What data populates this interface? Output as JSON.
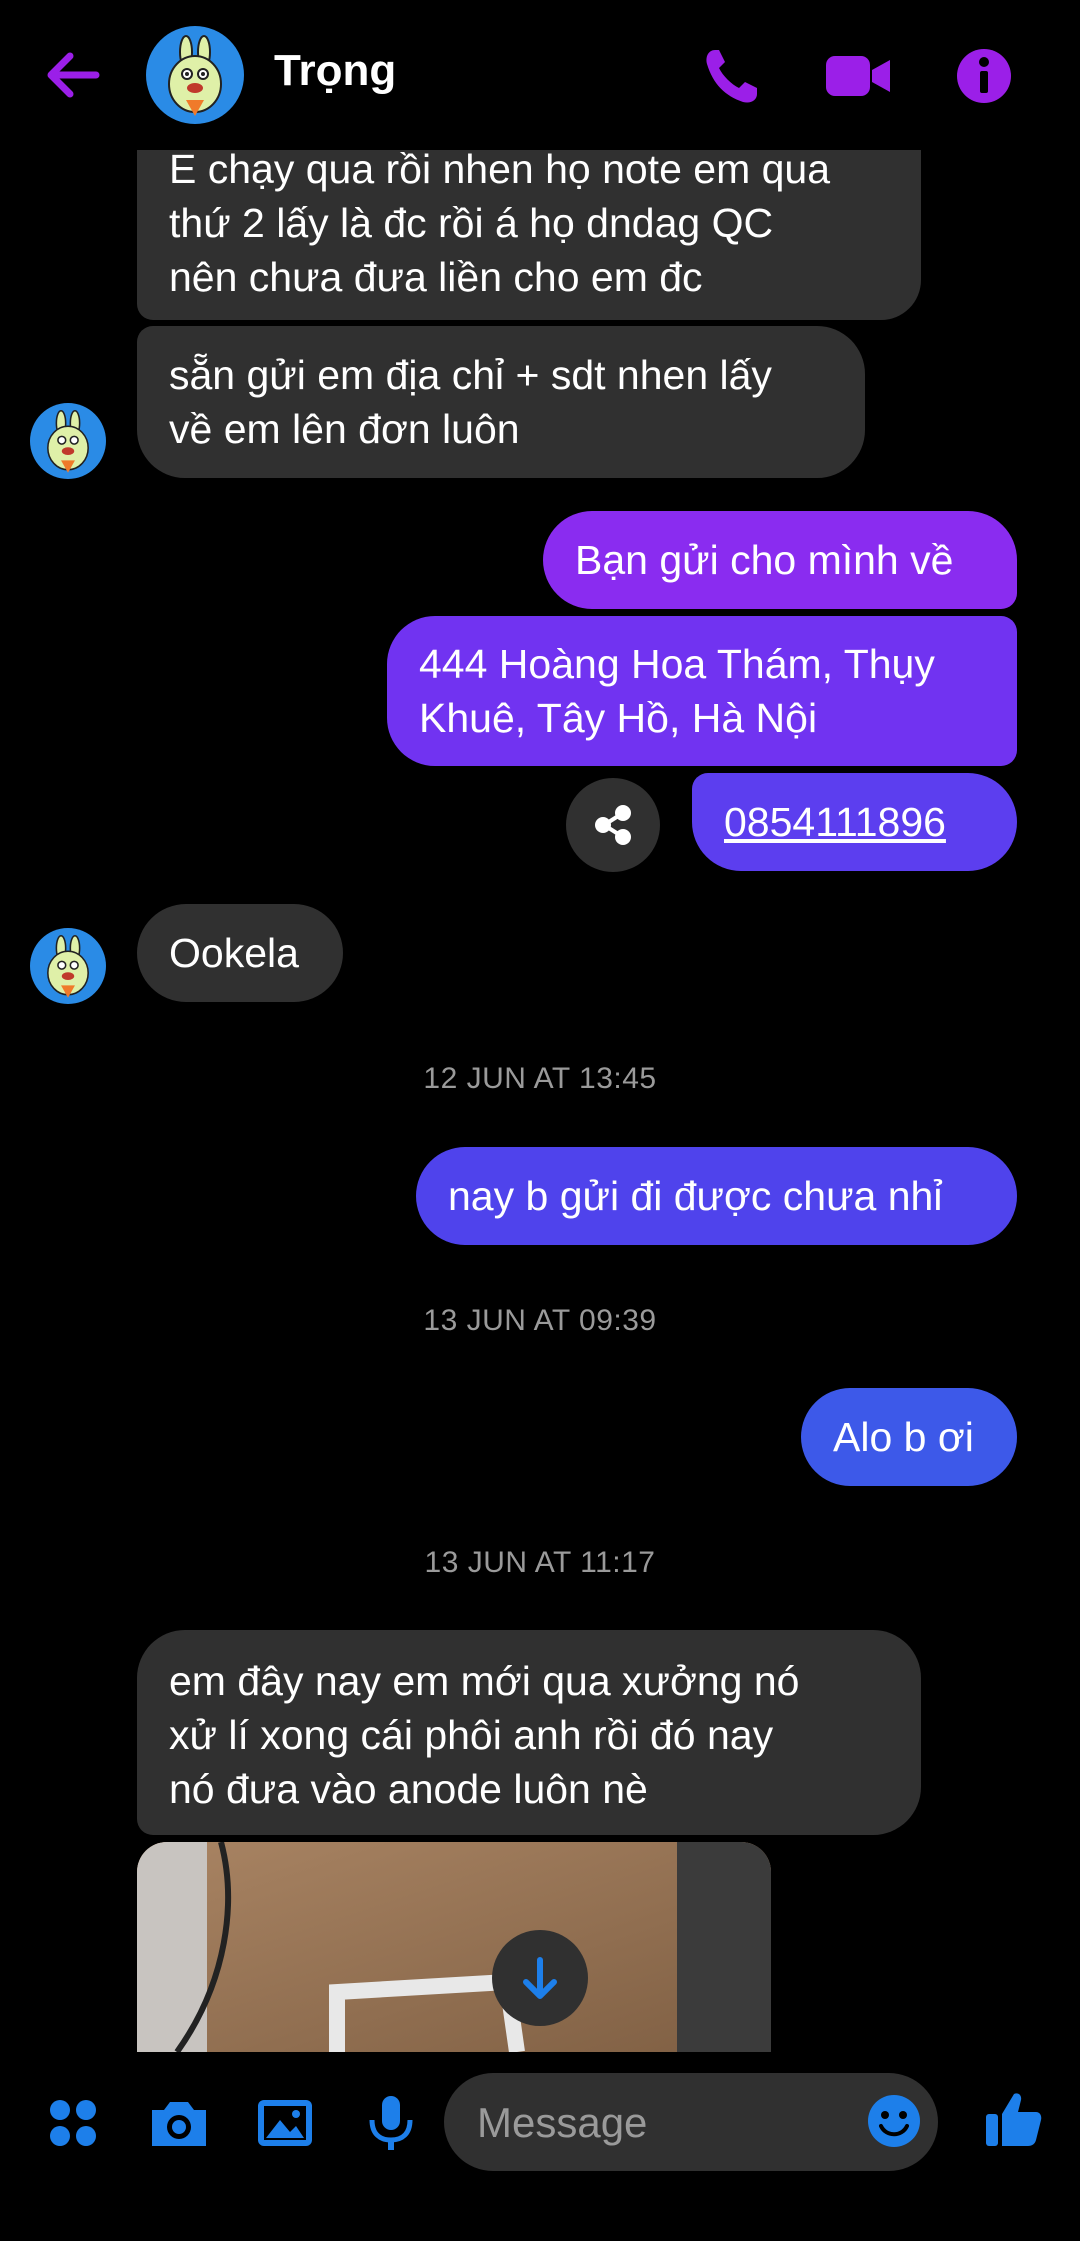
{
  "header": {
    "contact_name": "Trọng"
  },
  "messages": {
    "m1_line1": "E chạy qua rồi nhen họ note em qua",
    "m1_line2": "thứ 2 lấy là đc rồi á họ dndag QC",
    "m1_line3": "nên chưa đưa liền cho em đc",
    "m2_line1": "sẵn gửi em địa chỉ + sdt nhen lấy",
    "m2_line2": "về em lên đơn luôn",
    "m3": "Bạn gửi cho mình về",
    "m4_line1": "444 Hoàng Hoa Thám, Thụy",
    "m4_line2": "Khuê, Tây Hồ, Hà Nội",
    "m5_phone": "0854111896",
    "m6": "Ookela",
    "ts1": "12 JUN AT 13:45",
    "m7": "nay b gửi đi được chưa nhỉ",
    "ts2": "13 JUN AT 09:39",
    "m8": "Alo b ơi",
    "ts3": "13 JUN AT 11:17",
    "m9_line1": "em đây nay em mới qua xưởng nó",
    "m9_line2": "xử lí xong cái phôi anh rồi đó nay",
    "m9_line3": "nó đưa vào anode luôn nè"
  },
  "composer": {
    "placeholder": "Message"
  },
  "colors": {
    "accent": "#9b1fe8",
    "bubble_in": "#303030",
    "bubble_out_top": "#8a2cf0",
    "bubble_out_mid": "#7133f1",
    "bubble_out_low": "#4f43ec",
    "bubble_out_bottom": "#3d59e9",
    "composer_icon": "#1d7fea"
  },
  "icons": [
    "back-arrow-icon",
    "phone-icon",
    "video-camera-icon",
    "info-icon",
    "share-icon",
    "chevron-down-icon",
    "apps-grid-icon",
    "camera-icon",
    "image-gallery-icon",
    "microphone-icon",
    "emoji-icon",
    "thumbs-up-icon"
  ]
}
